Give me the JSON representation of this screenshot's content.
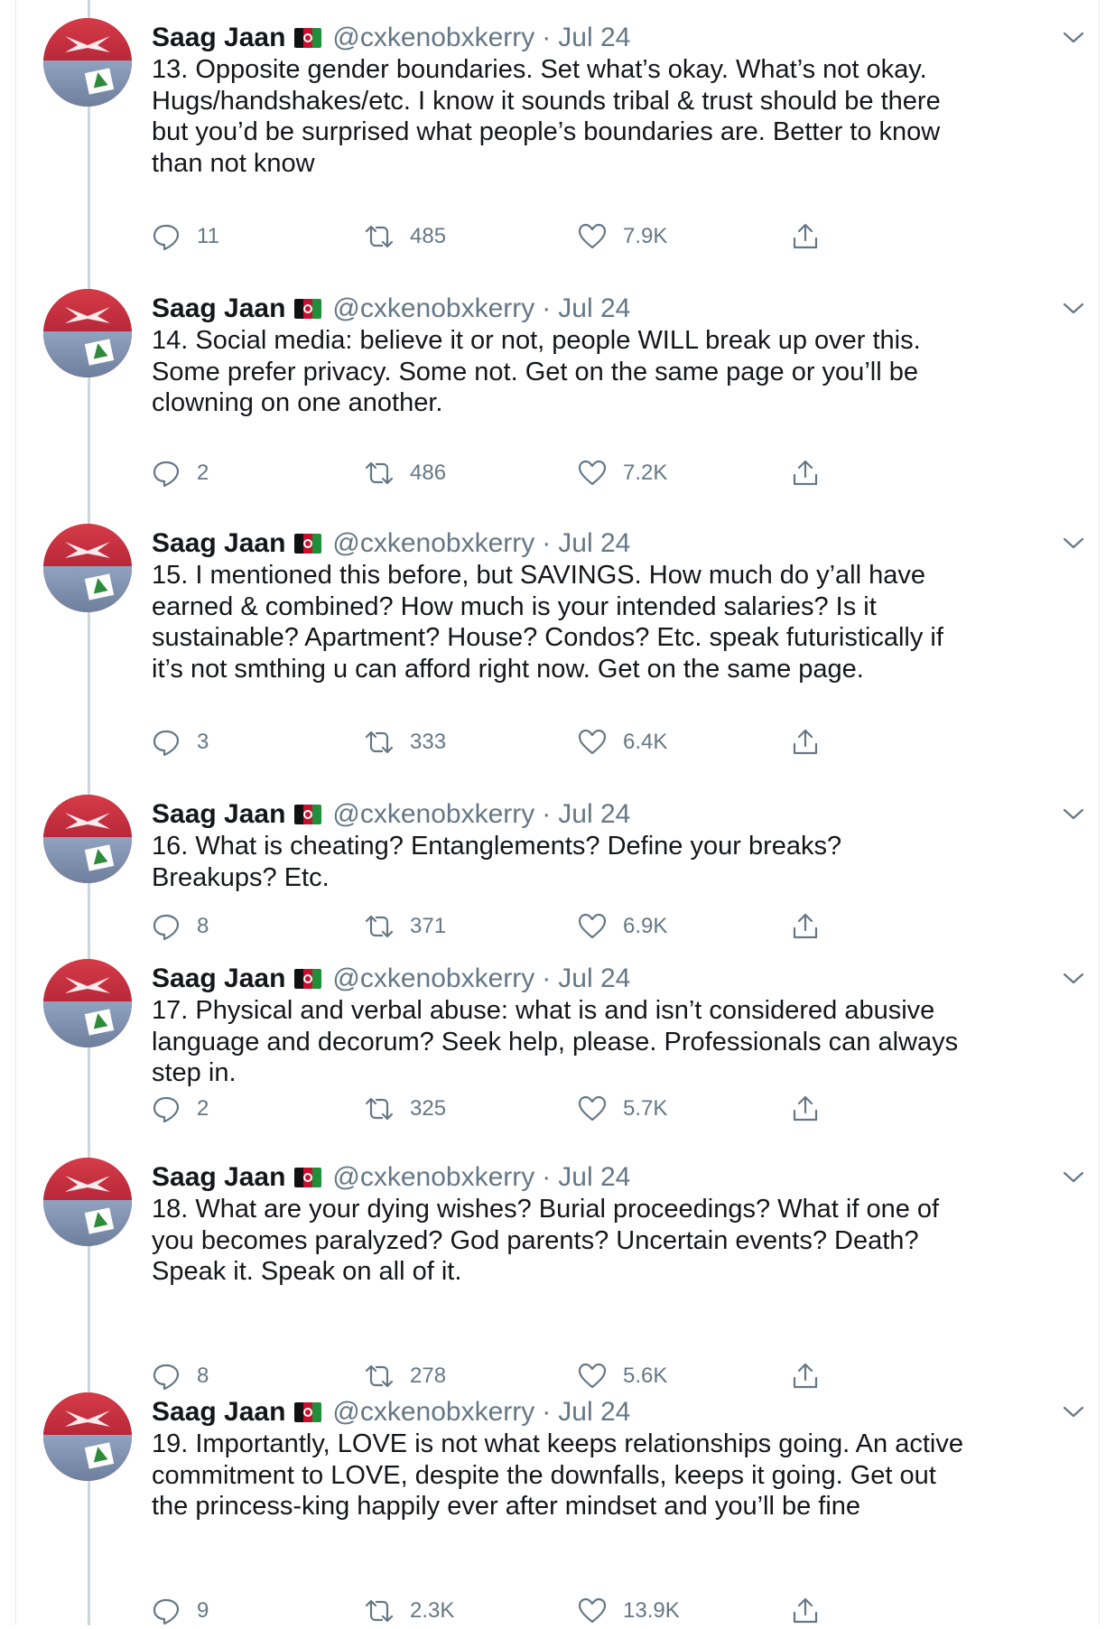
{
  "tweets": [
    {
      "name": "Saag Jaan",
      "handle": "@cxkenobxkerry",
      "dot": "·",
      "date": "Jul 24",
      "text": "13. Opposite gender boundaries. Set what’s okay. What’s not okay. Hugs/handshakes/etc. I know it sounds tribal & trust should be there but you’d be surprised what people’s boundaries are. Better to know than not know",
      "replies": "11",
      "retweets": "485",
      "likes": "7.9K"
    },
    {
      "name": "Saag Jaan",
      "handle": "@cxkenobxkerry",
      "dot": "·",
      "date": "Jul 24",
      "text": "14. Social media: believe it or not, people WILL break up over this. Some prefer privacy. Some not. Get on the same page or you’ll be clowning on one another.",
      "replies": "2",
      "retweets": "486",
      "likes": "7.2K"
    },
    {
      "name": "Saag Jaan",
      "handle": "@cxkenobxkerry",
      "dot": "·",
      "date": "Jul 24",
      "text": "15. I mentioned this before, but SAVINGS. How much do y’all have earned & combined? How much is your intended salaries? Is it sustainable? Apartment? House? Condos? Etc. speak futuristically if it’s not smthing u can afford right now. Get on the same page.",
      "replies": "3",
      "retweets": "333",
      "likes": "6.4K"
    },
    {
      "name": "Saag Jaan",
      "handle": "@cxkenobxkerry",
      "dot": "·",
      "date": "Jul 24",
      "text": "16. What is cheating? Entanglements? Define your breaks? Breakups? Etc.",
      "replies": "8",
      "retweets": "371",
      "likes": "6.9K"
    },
    {
      "name": "Saag Jaan",
      "handle": "@cxkenobxkerry",
      "dot": "·",
      "date": "Jul 24",
      "text": "17. Physical and verbal abuse: what is and isn’t considered abusive language and decorum? Seek help, please. Professionals can always step in.",
      "replies": "2",
      "retweets": "325",
      "likes": "5.7K"
    },
    {
      "name": "Saag Jaan",
      "handle": "@cxkenobxkerry",
      "dot": "·",
      "date": "Jul 24",
      "text": "18. What are your dying wishes? Burial proceedings? What if one of you becomes paralyzed? God parents? Uncertain events? Death? Speak it. Speak on all of it.",
      "replies": "8",
      "retweets": "278",
      "likes": "5.6K"
    },
    {
      "name": "Saag Jaan",
      "handle": "@cxkenobxkerry",
      "dot": "·",
      "date": "Jul 24",
      "text": "19. Importantly, LOVE is not what keeps relationships going. An active commitment to LOVE, despite the downfalls, keeps it going. Get out the princess-king happily ever after mindset and you’ll be fine",
      "replies": "9",
      "retweets": "2.3K",
      "likes": "13.9K"
    }
  ],
  "icons": {
    "reply": "reply-icon",
    "retweet": "retweet-icon",
    "like": "heart-icon",
    "share": "share-icon",
    "caret": "chevron-down-icon",
    "flag": "afghanistan-flag-icon"
  },
  "colors": {
    "muted": "#657786",
    "text": "#14171a",
    "thread_line": "#ccd6dd",
    "border": "#e6ecf0"
  }
}
